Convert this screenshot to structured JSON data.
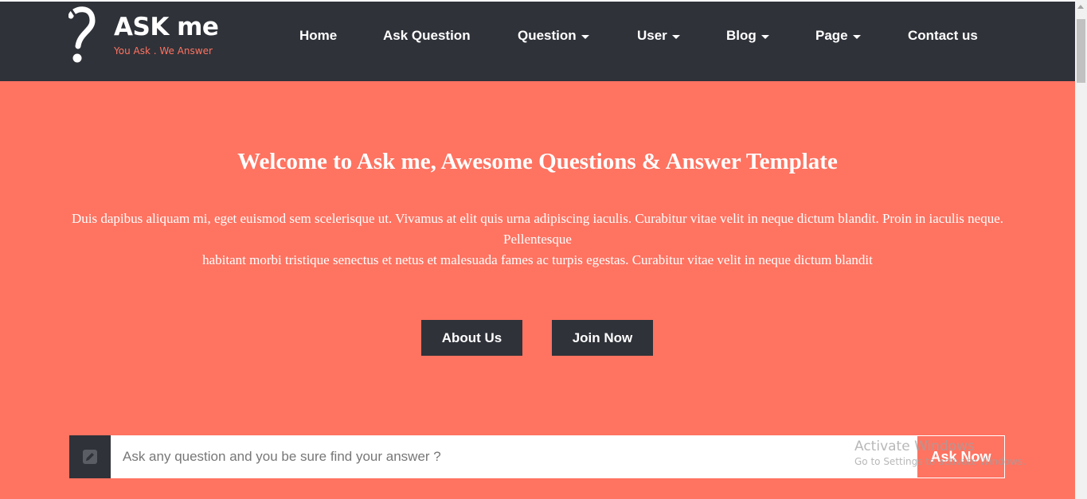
{
  "brand": {
    "name": "ASK me",
    "tagline": "You Ask . We Answer"
  },
  "nav": {
    "items": [
      {
        "label": "Home",
        "has_dropdown": false
      },
      {
        "label": "Ask Question",
        "has_dropdown": false
      },
      {
        "label": "Question",
        "has_dropdown": true
      },
      {
        "label": "User",
        "has_dropdown": true
      },
      {
        "label": "Blog",
        "has_dropdown": true
      },
      {
        "label": "Page",
        "has_dropdown": true
      },
      {
        "label": "Contact us",
        "has_dropdown": false
      }
    ]
  },
  "hero": {
    "title": "Welcome to Ask me, Awesome Questions & Answer Template",
    "description_line1": "Duis dapibus aliquam mi, eget euismod sem scelerisque ut. Vivamus at elit quis urna adipiscing iaculis. Curabitur vitae velit in neque dictum blandit. Proin in iaculis neque. Pellentesque",
    "description_line2": "habitant morbi tristique senectus et netus et malesuada fames ac turpis egestas. Curabitur vitae velit in neque dictum blandit",
    "about_button": "About Us",
    "join_button": "Join Now"
  },
  "ask": {
    "placeholder": "Ask any question and you be sure find your answer ?",
    "value": "",
    "button_label": "Ask Now",
    "icon": "pencil-icon"
  },
  "watermark": {
    "title": "Activate Windows",
    "subtitle": "Go to Settings to activate Windows."
  },
  "colors": {
    "navbar": "#2f3239",
    "accent": "#ff7361",
    "text_light": "#ffffff"
  }
}
